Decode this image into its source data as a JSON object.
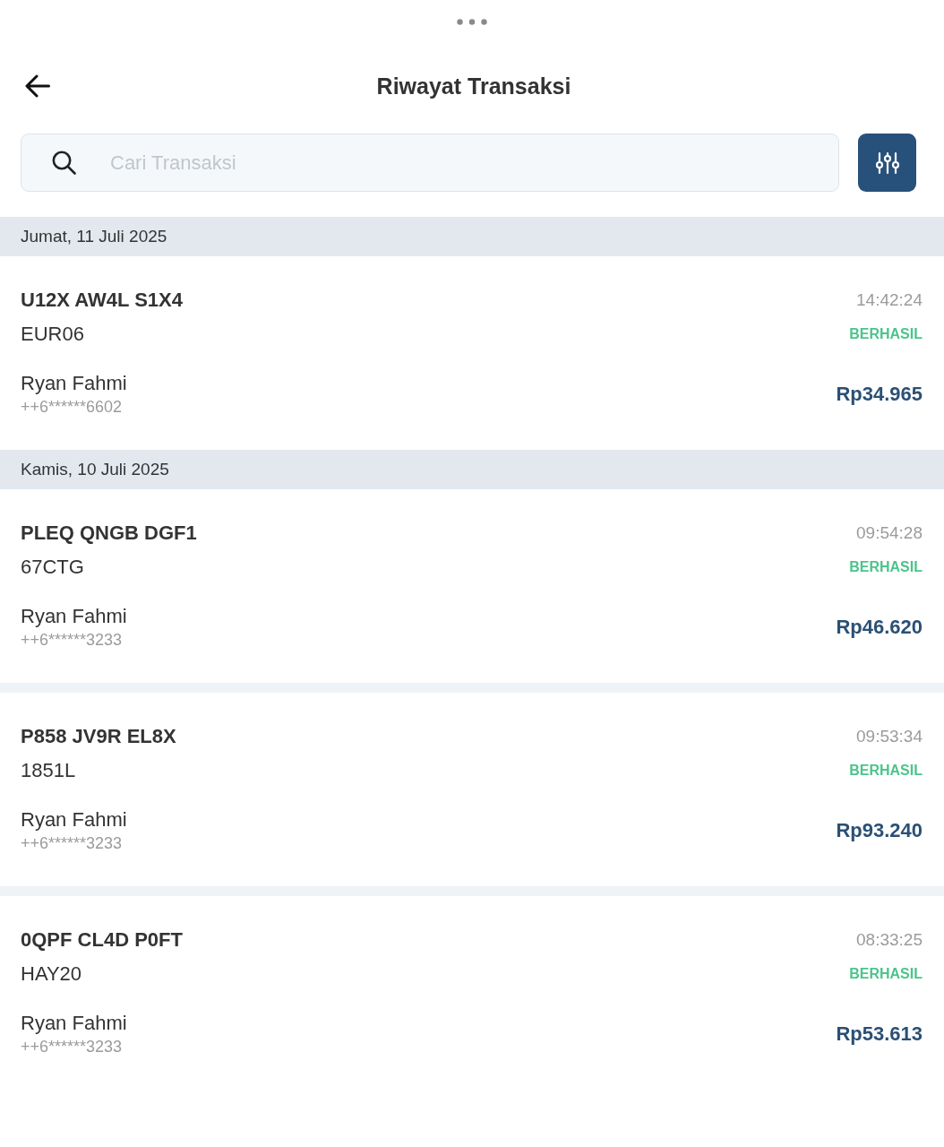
{
  "header": {
    "title": "Riwayat Transaksi"
  },
  "search": {
    "placeholder": "Cari Transaksi"
  },
  "groups": [
    {
      "date": "Jumat, 11 Juli 2025",
      "transactions": [
        {
          "code": "U12X AW4L S1X4",
          "reference": "EUR06",
          "time": "14:42:24",
          "status": "BERHASIL",
          "name": "Ryan Fahmi",
          "phone": "++6******6602",
          "amount": "Rp34.965"
        }
      ]
    },
    {
      "date": "Kamis, 10 Juli 2025",
      "transactions": [
        {
          "code": "PLEQ QNGB DGF1",
          "reference": "67CTG",
          "time": "09:54:28",
          "status": "BERHASIL",
          "name": "Ryan Fahmi",
          "phone": "++6******3233",
          "amount": "Rp46.620"
        },
        {
          "code": "P858 JV9R EL8X",
          "reference": "1851L",
          "time": "09:53:34",
          "status": "BERHASIL",
          "name": "Ryan Fahmi",
          "phone": "++6******3233",
          "amount": "Rp93.240"
        },
        {
          "code": "0QPF CL4D P0FT",
          "reference": "HAY20",
          "time": "08:33:25",
          "status": "BERHASIL",
          "name": "Ryan Fahmi",
          "phone": "++6******3233",
          "amount": "Rp53.613"
        }
      ]
    }
  ]
}
